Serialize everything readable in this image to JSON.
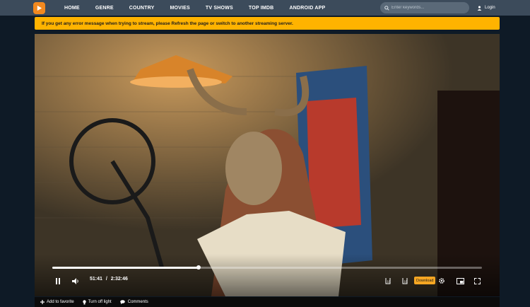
{
  "header": {
    "logo": "play-logo-icon",
    "nav": [
      "HOME",
      "GENRE",
      "COUNTRY",
      "MOVIES",
      "TV SHOWS",
      "TOP IMDB",
      "ANDROID APP"
    ],
    "search_placeholder": "Enter keywords...",
    "login_label": "Login"
  },
  "alert": {
    "message": "If you get any error message when trying to stream, please Refresh the page or switch to another streaming server.",
    "color": "#ffb300"
  },
  "player": {
    "progress": 0.34,
    "current_time": "51:41",
    "separator": "/",
    "duration": "2:32:46",
    "download_label": "Download",
    "icons": [
      "pause-icon",
      "volume-icon",
      "rewind-10-icon",
      "forward-10-icon",
      "settings-icon",
      "picture-in-picture-icon",
      "fullscreen-icon"
    ]
  },
  "actions": {
    "favorite": "Add to favorite",
    "light": "Turn off light",
    "comments": "Comments"
  }
}
